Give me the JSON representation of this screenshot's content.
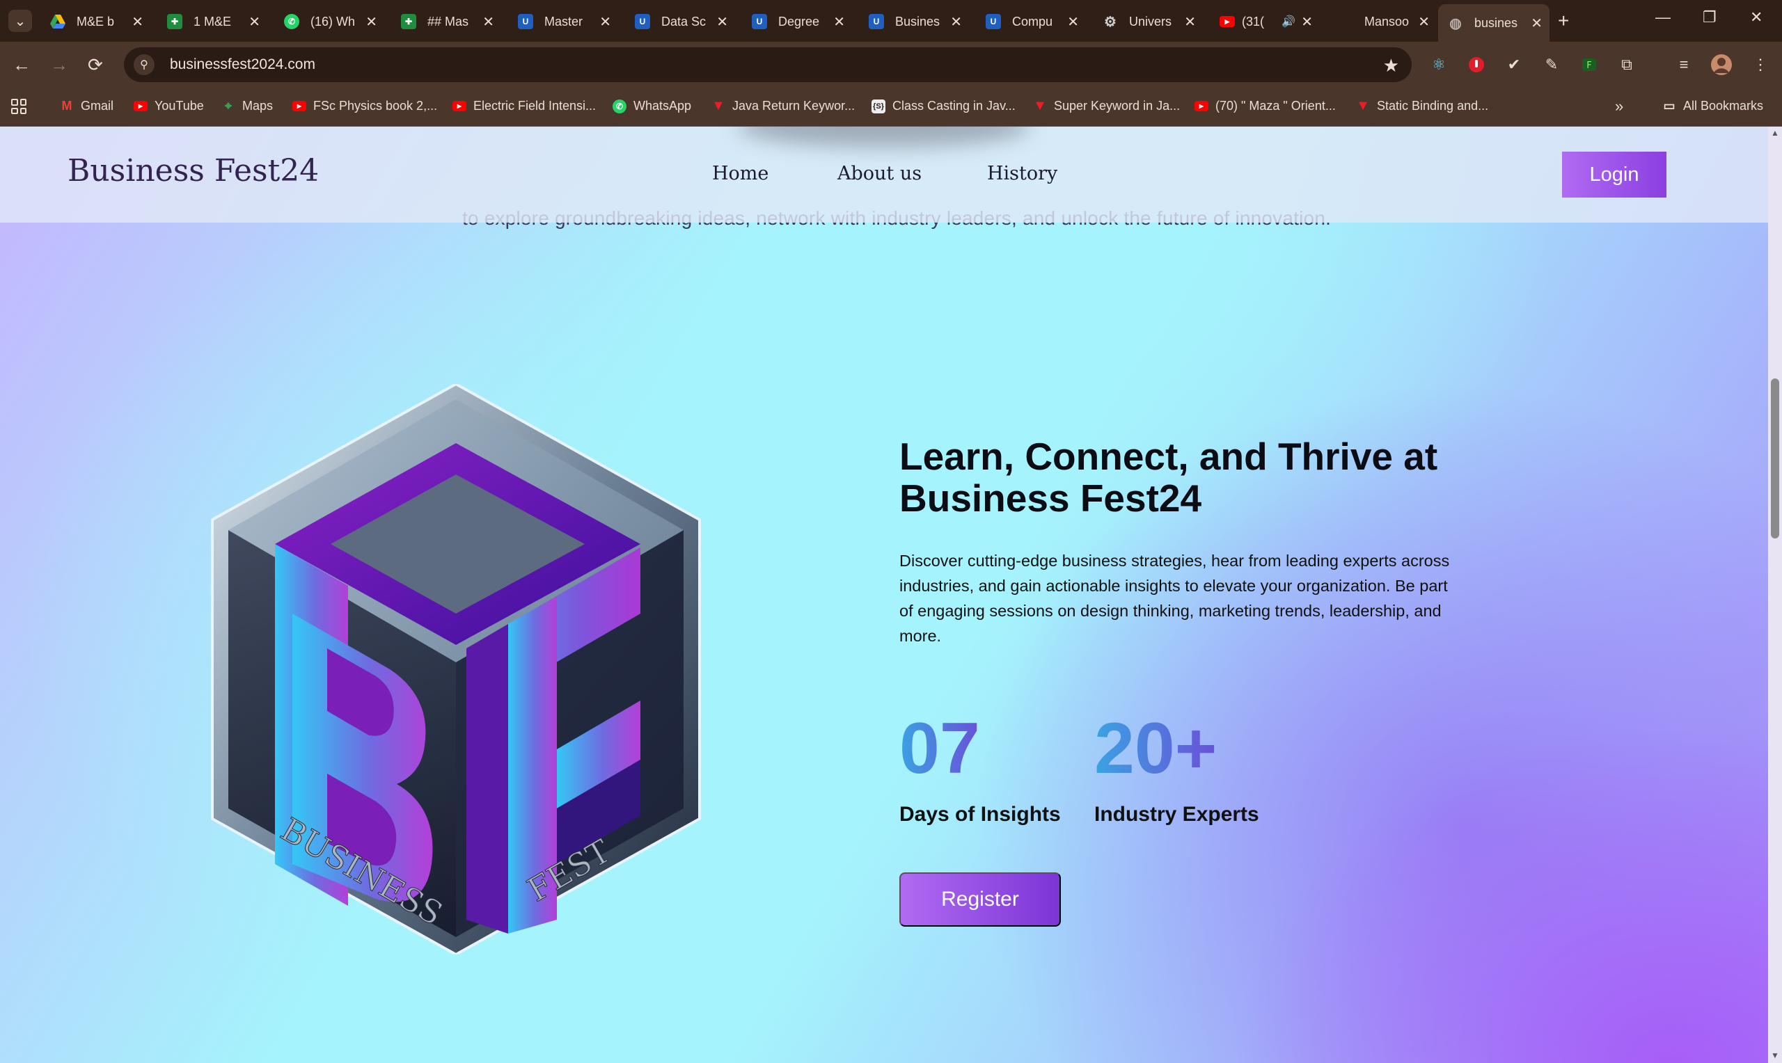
{
  "browser": {
    "tabs": [
      {
        "label": "M&E b",
        "icon": "google-drive-icon",
        "color": "#34a853"
      },
      {
        "label": "1 M&E",
        "icon": "google-sheets-icon",
        "color": "#1e8e3e"
      },
      {
        "label": "(16) Wh",
        "icon": "whatsapp-icon",
        "color": "#25d366"
      },
      {
        "label": "## Mas",
        "icon": "google-sheets-icon",
        "color": "#1e8e3e"
      },
      {
        "label": "Master",
        "icon": "university-icon",
        "color": "#1f5fbf"
      },
      {
        "label": "Data Sc",
        "icon": "university-icon",
        "color": "#1f5fbf"
      },
      {
        "label": "Degree",
        "icon": "university-icon",
        "color": "#1f5fbf"
      },
      {
        "label": "Busines",
        "icon": "university-icon",
        "color": "#1f5fbf"
      },
      {
        "label": "Compu",
        "icon": "university-icon",
        "color": "#1f5fbf"
      },
      {
        "label": "Univers",
        "icon": "openai-icon",
        "color": "#cfcfcf"
      },
      {
        "label": "(31(",
        "icon": "youtube-icon",
        "color": "#ff0000"
      },
      {
        "label": "Mansoo",
        "icon": "",
        "color": ""
      },
      {
        "label": "busines",
        "icon": "globe-icon",
        "color": "#9a9a9a"
      }
    ],
    "url": "businessfest2024.com",
    "bookmarks": [
      {
        "label": "Gmail",
        "icon": "gmail-icon"
      },
      {
        "label": "YouTube",
        "icon": "youtube-icon"
      },
      {
        "label": "Maps",
        "icon": "maps-icon"
      },
      {
        "label": "FSc Physics book 2,...",
        "icon": "youtube-icon"
      },
      {
        "label": "Electric Field Intensi...",
        "icon": "youtube-icon"
      },
      {
        "label": "WhatsApp",
        "icon": "whatsapp-icon"
      },
      {
        "label": "Java Return Keywor...",
        "icon": "tutorial-icon"
      },
      {
        "label": "Class Casting in Jav...",
        "icon": "code-icon"
      },
      {
        "label": "Super Keyword in Ja...",
        "icon": "tutorial-icon"
      },
      {
        "label": "(70) \" Maza \" Orient...",
        "icon": "youtube-icon"
      },
      {
        "label": "Static Binding and...",
        "icon": "tutorial-icon"
      }
    ],
    "all_bookmarks": "All Bookmarks"
  },
  "site": {
    "brand": "Business Fest24",
    "nav": {
      "home": "Home",
      "about": "About us",
      "history": "History"
    },
    "login": "Login",
    "scrolled_text": "to explore groundbreaking ideas, network with industry leaders, and unlock the future of innovation.",
    "logo_text": {
      "letters_b": "B",
      "letters_f": "F",
      "left": "BUSINESS",
      "right": "FEST"
    },
    "headline": "Learn, Connect, and Thrive at Business Fest24",
    "description": "Discover cutting-edge business strategies, hear from leading experts across industries, and gain actionable insights to elevate your organization. Be part of engaging sessions on design thinking, marketing trends, leadership, and more.",
    "stats": [
      {
        "value": "07",
        "label": "Days of Insights"
      },
      {
        "value": "20+",
        "label": "Industry Experts"
      }
    ],
    "register": "Register"
  },
  "colors": {
    "accent_purple": "#9b4ee8",
    "stat_gradient_start": "#3aa3e3",
    "stat_gradient_end": "#6a4fd8"
  }
}
